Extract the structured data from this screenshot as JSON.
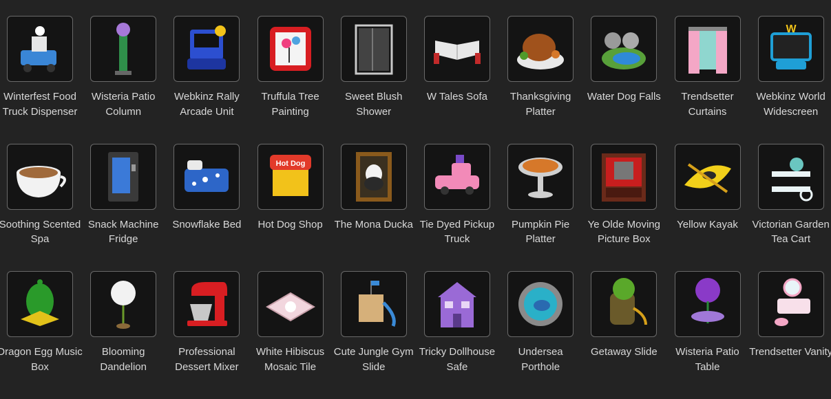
{
  "items": [
    {
      "label": "Winterfest Food Truck Dispenser",
      "icon": "food-truck-dispenser-icon",
      "color": "#3a86d6",
      "accent": "#e6e6e6"
    },
    {
      "label": "Wisteria Patio Column",
      "icon": "patio-column-icon",
      "color": "#2f8f4a",
      "accent": "#a678d8"
    },
    {
      "label": "Webkinz Rally Arcade Unit",
      "icon": "arcade-unit-icon",
      "color": "#2c4fd0",
      "accent": "#f2c31a"
    },
    {
      "label": "Truffula Tree Painting",
      "icon": "painting-icon",
      "color": "#d81e22",
      "accent": "#4fa3e0"
    },
    {
      "label": "Sweet Blush Shower",
      "icon": "shower-icon",
      "color": "#9a9a9a",
      "accent": "#c8c8c8"
    },
    {
      "label": "W Tales Sofa",
      "icon": "book-sofa-icon",
      "color": "#e8e8e8",
      "accent": "#c22a2a"
    },
    {
      "label": "Thanksgiving Platter",
      "icon": "turkey-platter-icon",
      "color": "#a0521c",
      "accent": "#4f9a2a"
    },
    {
      "label": "Water Dog Falls",
      "icon": "waterfall-icon",
      "color": "#2f8ad8",
      "accent": "#58a03a"
    },
    {
      "label": "Trendsetter Curtains",
      "icon": "curtains-icon",
      "color": "#f4a7c6",
      "accent": "#8fd6cf"
    },
    {
      "label": "Webkinz World Widescreen",
      "icon": "widescreen-tv-icon",
      "color": "#1f9fd6",
      "accent": "#f0c21a"
    },
    {
      "label": "Soothing Scented Spa",
      "icon": "spa-cup-icon",
      "color": "#a06a3c",
      "accent": "#f2f2f2"
    },
    {
      "label": "Snack Machine Fridge",
      "icon": "snack-machine-icon",
      "color": "#3a3a3a",
      "accent": "#3b7ad8"
    },
    {
      "label": "Snowflake Bed",
      "icon": "bed-icon",
      "color": "#2d66c8",
      "accent": "#ffffff"
    },
    {
      "label": "Hot Dog Shop",
      "icon": "hot-dog-shop-icon",
      "color": "#e23a2a",
      "accent": "#f2c21a"
    },
    {
      "label": "The Mona Ducka",
      "icon": "framed-portrait-icon",
      "color": "#8a5a1c",
      "accent": "#2a2a2a"
    },
    {
      "label": "Tie Dyed Pickup Truck",
      "icon": "pickup-truck-icon",
      "color": "#f28ab8",
      "accent": "#7a4ac8"
    },
    {
      "label": "Pumpkin Pie Platter",
      "icon": "pie-platter-icon",
      "color": "#d6782a",
      "accent": "#d0d0d0"
    },
    {
      "label": "Ye Olde Moving Picture Box",
      "icon": "theatre-box-icon",
      "color": "#6a2a1a",
      "accent": "#c81e1e"
    },
    {
      "label": "Yellow Kayak",
      "icon": "kayak-icon",
      "color": "#f2d01a",
      "accent": "#2a2a2a"
    },
    {
      "label": "Victorian Garden Tea Cart",
      "icon": "tea-cart-icon",
      "color": "#eaf4f6",
      "accent": "#6ac6c0"
    },
    {
      "label": "Dragon Egg Music Box",
      "icon": "dragon-egg-icon",
      "color": "#2a9a2a",
      "accent": "#e2c21a"
    },
    {
      "label": "Blooming Dandelion",
      "icon": "dandelion-icon",
      "color": "#f2f2f2",
      "accent": "#6a9a2a"
    },
    {
      "label": "Professional Dessert Mixer",
      "icon": "stand-mixer-icon",
      "color": "#d81e22",
      "accent": "#c8c8c8"
    },
    {
      "label": "White Hibiscus Mosaic Tile",
      "icon": "mosaic-tile-icon",
      "color": "#f2d6de",
      "accent": "#c8a0aa"
    },
    {
      "label": "Cute Jungle Gym Slide",
      "icon": "jungle-gym-icon",
      "color": "#d6b07a",
      "accent": "#3a8ad6"
    },
    {
      "label": "Tricky Dollhouse Safe",
      "icon": "dollhouse-icon",
      "color": "#9a6ad6",
      "accent": "#e8d6f6"
    },
    {
      "label": "Undersea Porthole",
      "icon": "porthole-icon",
      "color": "#2ab0c8",
      "accent": "#8a8a8a"
    },
    {
      "label": "Getaway Slide",
      "icon": "tree-stump-slide-icon",
      "color": "#6a5a2a",
      "accent": "#5aa82a"
    },
    {
      "label": "Wisteria Patio Table",
      "icon": "patio-table-icon",
      "color": "#8a3ac8",
      "accent": "#2a8a3a"
    },
    {
      "label": "Trendsetter Vanity",
      "icon": "vanity-icon",
      "color": "#f4a7c6",
      "accent": "#f8e0ea"
    }
  ]
}
